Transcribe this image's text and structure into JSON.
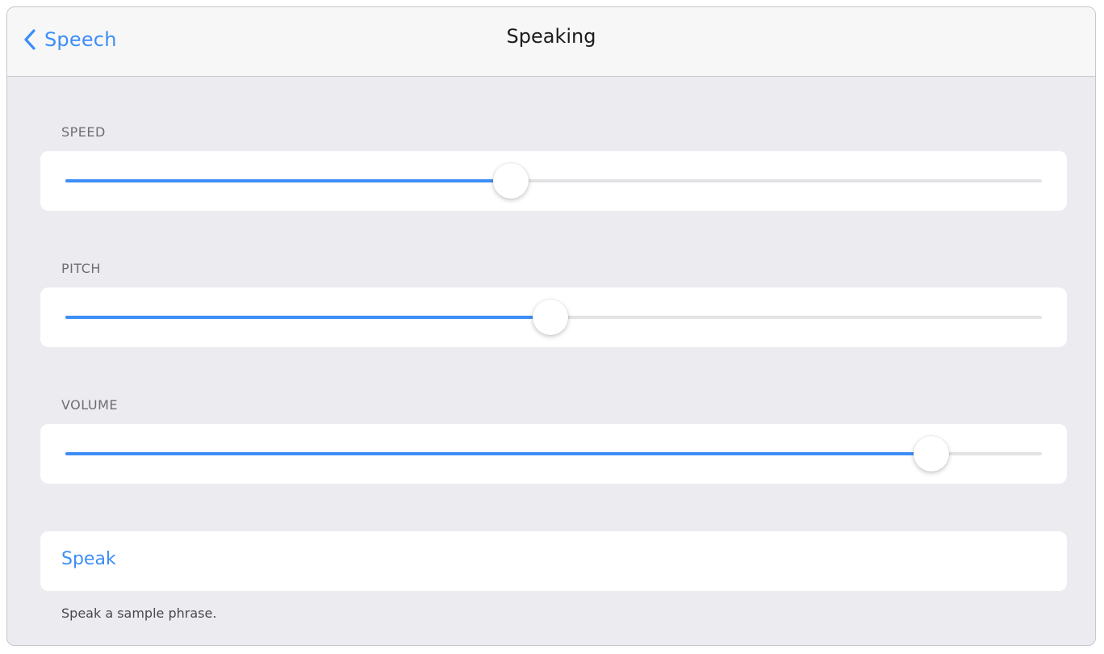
{
  "navbar": {
    "back_label": "Speech",
    "title": "Speaking"
  },
  "sliders": [
    {
      "label": "SPEED",
      "value": 0.456
    },
    {
      "label": "PITCH",
      "value": 0.497
    },
    {
      "label": "VOLUME",
      "value": 0.887
    }
  ],
  "speak": {
    "label": "Speak",
    "footer": "Speak a sample phrase."
  },
  "colors": {
    "accent": "#3e8ef7",
    "background": "#ebebf0",
    "track": "#e3e3e6"
  }
}
